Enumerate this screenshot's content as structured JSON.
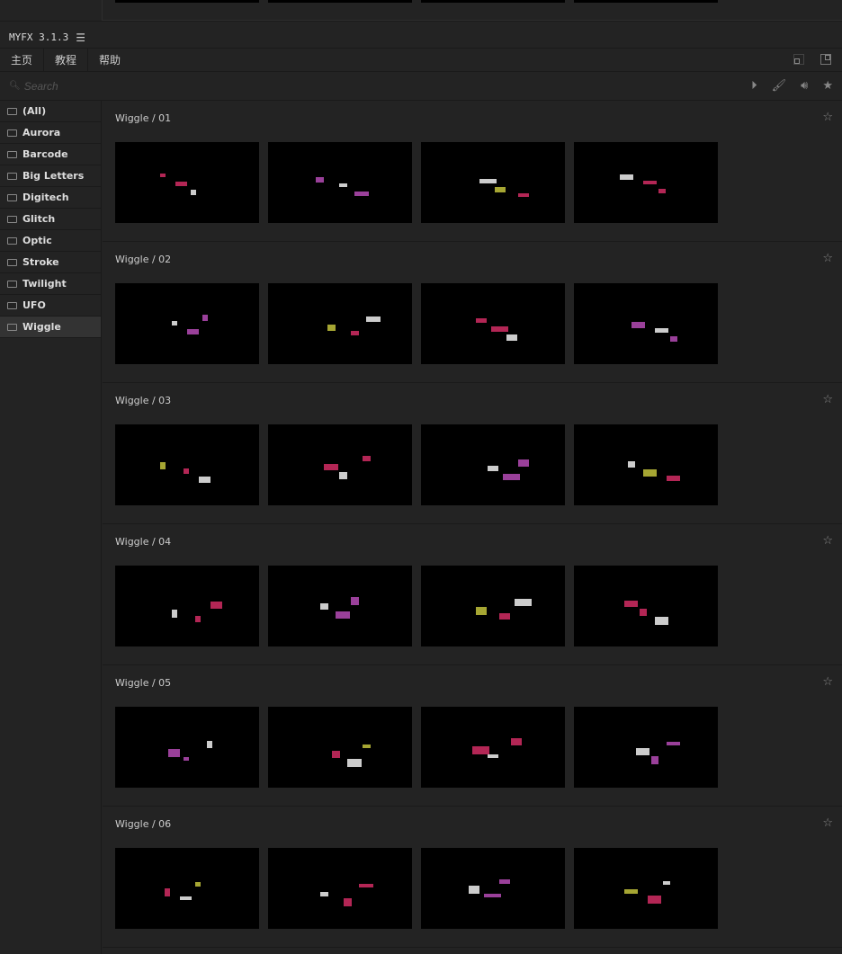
{
  "app": {
    "title": "MYFX 3.1.3",
    "menu_icon": "hamburger-icon"
  },
  "tabs": [
    {
      "label": "主页"
    },
    {
      "label": "教程"
    },
    {
      "label": "帮助"
    }
  ],
  "search": {
    "placeholder": "Search"
  },
  "sidebar": {
    "items": [
      {
        "label": "(All)"
      },
      {
        "label": "Aurora"
      },
      {
        "label": "Barcode"
      },
      {
        "label": "Big Letters"
      },
      {
        "label": "Digitech"
      },
      {
        "label": "Glitch"
      },
      {
        "label": "Optic"
      },
      {
        "label": "Stroke"
      },
      {
        "label": "Twilight"
      },
      {
        "label": "UFO"
      },
      {
        "label": "Wiggle",
        "active": true
      }
    ]
  },
  "sections": [
    {
      "title": "Wiggle / 01"
    },
    {
      "title": "Wiggle / 02"
    },
    {
      "title": "Wiggle / 03"
    },
    {
      "title": "Wiggle / 04"
    },
    {
      "title": "Wiggle / 05"
    },
    {
      "title": "Wiggle / 06"
    }
  ],
  "colors": {
    "accent": "#e0306a",
    "bg": "#232323"
  }
}
